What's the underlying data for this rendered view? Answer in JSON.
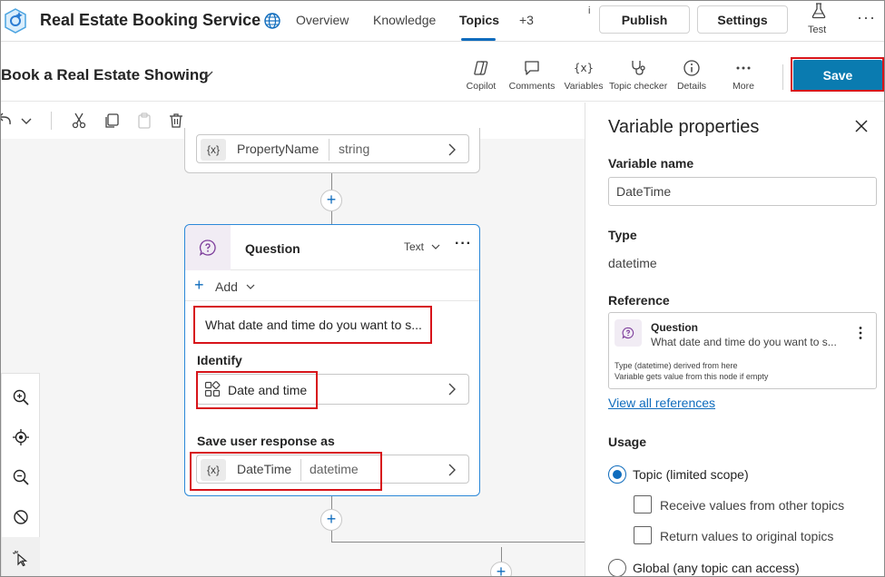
{
  "app": {
    "title": "Real Estate Booking Service",
    "nav": [
      "Overview",
      "Knowledge",
      "Topics",
      "+3"
    ],
    "active_tab": "Topics",
    "info_marker": "i",
    "publish_label": "Publish",
    "settings_label": "Settings",
    "test_label": "Test",
    "more_glyph": "···"
  },
  "topic": {
    "title": "Book a Real Estate Showing",
    "tools": [
      "Copilot",
      "Comments",
      "Variables",
      "Topic checker",
      "Details",
      "More"
    ],
    "save_label": "Save"
  },
  "canvas": {
    "prev_node": {
      "var_glyph": "{x}",
      "var_name": "PropertyName",
      "var_type": "string"
    },
    "question_node": {
      "title": "Question",
      "mode": "Text",
      "more_glyph": "···",
      "add_label": "Add",
      "message": "What date and time do you want to s...",
      "identify_label": "Identify",
      "entity": "Date and time",
      "save_response_label": "Save user response as",
      "var_glyph": "{x}",
      "var_name": "DateTime",
      "var_type": "datetime"
    },
    "plus_glyph": "+"
  },
  "panel": {
    "title": "Variable properties",
    "variable_name_label": "Variable name",
    "variable_name_value": "DateTime",
    "type_label": "Type",
    "type_value": "datetime",
    "reference_label": "Reference",
    "reference": {
      "title": "Question",
      "text": "What date and time do you want to s...",
      "note1": "Type (datetime) derived from here",
      "note2": "Variable gets value from this node if empty"
    },
    "view_all_label": "View all references",
    "usage_label": "Usage",
    "topic_scope_label": "Topic (limited scope)",
    "receive_label": "Receive values from other topics",
    "return_label": "Return values to original topics",
    "global_label": "Global (any topic can access)"
  },
  "colors": {
    "accent": "#0f6cbd",
    "save_button": "#0a7bb0",
    "highlight_box": "#d7141a",
    "question_icon_bg": "#f1ecf4"
  }
}
